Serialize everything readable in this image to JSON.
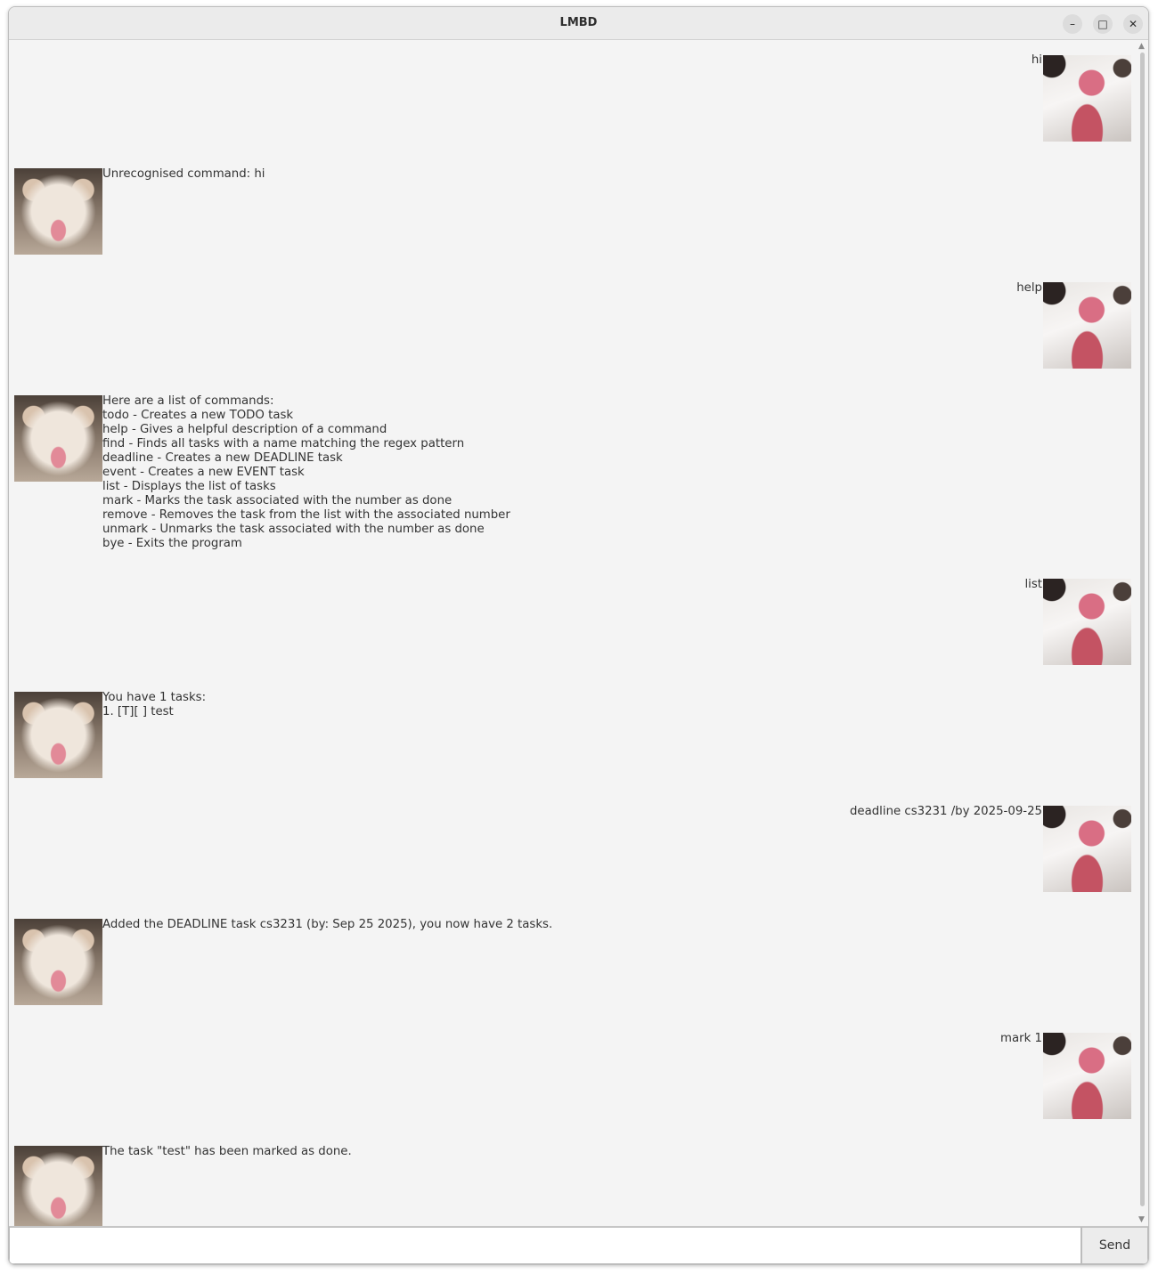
{
  "window": {
    "title": "LMBD",
    "buttons": {
      "minimize": "–",
      "maximize": "□",
      "close": "✕"
    }
  },
  "messages": [
    {
      "sender": "user",
      "text": "hi"
    },
    {
      "sender": "bot",
      "text": "Unrecognised command: hi"
    },
    {
      "sender": "user",
      "text": "help"
    },
    {
      "sender": "bot",
      "text": "Here are a list of commands:\ntodo - Creates a new TODO task\nhelp - Gives a helpful description of a command\nfind - Finds all tasks with a name matching the regex pattern\ndeadline - Creates a new DEADLINE task\nevent - Creates a new EVENT task\nlist - Displays the list of tasks\nmark - Marks the task associated with the number as done\nremove - Removes the task from the list with the associated number\nunmark - Unmarks the task associated with the number as done\nbye - Exits the program"
    },
    {
      "sender": "user",
      "text": "list"
    },
    {
      "sender": "bot",
      "text": "You have 1 tasks:\n1. [T][ ] test"
    },
    {
      "sender": "user",
      "text": "deadline cs3231 /by 2025-09-25"
    },
    {
      "sender": "bot",
      "text": "Added the DEADLINE task cs3231 (by: Sep 25 2025), you now have 2 tasks."
    },
    {
      "sender": "user",
      "text": "mark 1"
    },
    {
      "sender": "bot",
      "text": "The task \"test\" has been marked as done."
    }
  ],
  "input": {
    "value": "",
    "send_label": "Send"
  },
  "scrollbar": {
    "up": "▲",
    "down": "▼"
  }
}
